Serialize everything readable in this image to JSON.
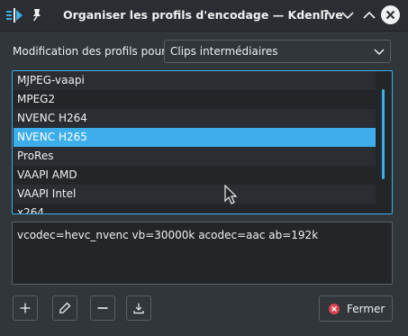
{
  "window": {
    "title": "Organiser les profils d'encodage — Kdenlive",
    "help_glyph": "?",
    "icons": [
      "kdenlive-app-icon",
      "pin-icon",
      "help-icon",
      "minimize-icon",
      "maximize-icon",
      "close-icon"
    ]
  },
  "profile_selector": {
    "label": "Modification des profils pour",
    "value": "Clips intermédiaires"
  },
  "profiles": {
    "items": [
      "MJPEG-vaapi",
      "MPEG2",
      "NVENC H264",
      "NVENC H265",
      "ProRes",
      "VAAPI AMD",
      "VAAPI Intel",
      "x264"
    ],
    "selected": "NVENC H265"
  },
  "parameters": {
    "text": "vcodec=hevc_nvenc vb=30000k acodec=aac ab=192k"
  },
  "toolbar": {
    "icons": [
      "add-icon",
      "edit-icon",
      "remove-icon",
      "download-icon"
    ]
  },
  "close_button": {
    "label": "Fermer",
    "icon": "close-circle-icon"
  },
  "colors": {
    "accent": "#3daee9",
    "window_bg": "#31363b",
    "titlebar_bg": "#2a2e32",
    "close_icon": "#da4453"
  }
}
